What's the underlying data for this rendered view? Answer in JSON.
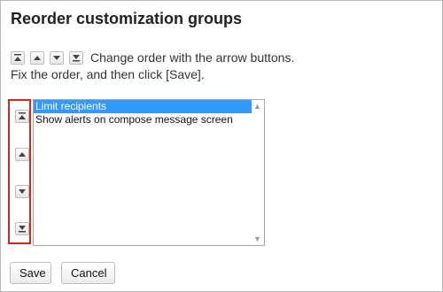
{
  "header": {
    "title": "Reorder customization groups"
  },
  "instructions": {
    "line1": "Change order with the arrow buttons.",
    "line2": "Fix the order, and then click [Save]."
  },
  "icons": {
    "move_top": "move-to-top-icon",
    "move_up": "move-up-icon",
    "move_down": "move-down-icon",
    "move_bottom": "move-to-bottom-icon"
  },
  "list": {
    "items": [
      {
        "label": "Limit recipients",
        "selected": true
      },
      {
        "label": "Show alerts on compose message screen",
        "selected": false
      }
    ]
  },
  "actions": {
    "save_label": "Save",
    "cancel_label": "Cancel"
  },
  "colors": {
    "highlight": "#d9261c",
    "selected_bg": "#3399ff"
  }
}
